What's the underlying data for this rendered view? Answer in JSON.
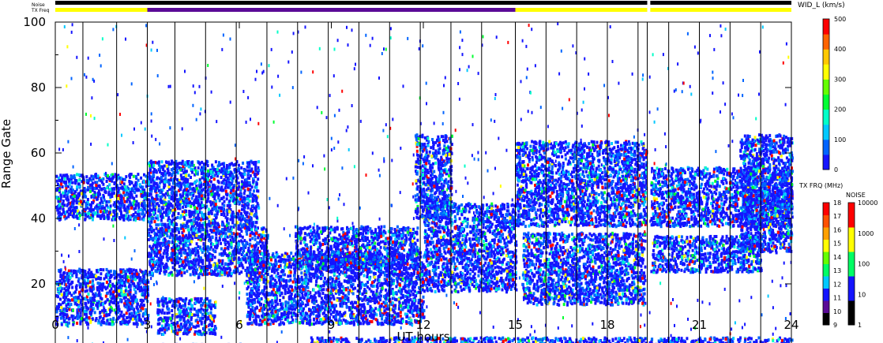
{
  "header": {
    "noise_label": "Noise",
    "txfreq_label": "TX Freq"
  },
  "chart_data": {
    "type": "heatmap",
    "title": "",
    "xlabel": "UT hours",
    "ylabel": "Range Gate",
    "xlim": [
      0,
      24
    ],
    "ylim": [
      0,
      100
    ],
    "x_ticks": [
      "0",
      "3",
      "6",
      "9",
      "12",
      "15",
      "18",
      "21",
      "24"
    ],
    "y_ticks": [
      "0",
      "20",
      "40",
      "60",
      "80",
      "100"
    ],
    "grid_vertical_hours": [
      0.9,
      2.0,
      3.0,
      3.9,
      4.9,
      5.9,
      6.9,
      7.9,
      8.9,
      9.9,
      10.9,
      11.9,
      12.9,
      13.9,
      15.0,
      16.0,
      17.0,
      18.0,
      19.0,
      20.0,
      21.0,
      22.0,
      23.0
    ],
    "data_gap_hour": 19.3,
    "noise_bar": [
      {
        "start": 0,
        "end": 19.3,
        "color": "#000000"
      },
      {
        "start": 19.4,
        "end": 24,
        "color": "#000000"
      }
    ],
    "txfreq_bar": [
      {
        "start": 0,
        "end": 3.0,
        "color": "#ffff00"
      },
      {
        "start": 3.0,
        "end": 15.0,
        "color": "#5a0a96"
      },
      {
        "start": 15.0,
        "end": 19.3,
        "color": "#ffff00"
      },
      {
        "start": 19.4,
        "end": 24,
        "color": "#ffff00"
      }
    ],
    "scatter_bands": [
      {
        "t0": 0.0,
        "t1": 3.0,
        "g0": 8,
        "g1": 25
      },
      {
        "t0": 0.0,
        "t1": 3.0,
        "g0": 40,
        "g1": 54
      },
      {
        "t0": 3.0,
        "t1": 6.9,
        "g0": 23,
        "g1": 38
      },
      {
        "t0": 3.0,
        "t1": 6.6,
        "g0": 38,
        "g1": 58
      },
      {
        "t0": 3.3,
        "t1": 5.2,
        "g0": 5,
        "g1": 16
      },
      {
        "t0": 6.2,
        "t1": 12.0,
        "g0": 8,
        "g1": 30
      },
      {
        "t0": 7.8,
        "t1": 11.8,
        "g0": 25,
        "g1": 38
      },
      {
        "t0": 12.0,
        "t1": 15.0,
        "g0": 18,
        "g1": 45
      },
      {
        "t0": 11.7,
        "t1": 12.9,
        "g0": 40,
        "g1": 66
      },
      {
        "t0": 15.0,
        "t1": 19.3,
        "g0": 38,
        "g1": 64
      },
      {
        "t0": 15.2,
        "t1": 19.2,
        "g0": 14,
        "g1": 36
      },
      {
        "t0": 19.4,
        "t1": 24.0,
        "g0": 38,
        "g1": 56
      },
      {
        "t0": 19.4,
        "t1": 23.0,
        "g0": 24,
        "g1": 35
      },
      {
        "t0": 22.3,
        "t1": 24.0,
        "g0": 30,
        "g1": 66
      },
      {
        "t0": 8.3,
        "t1": 24.0,
        "g0": 0,
        "g1": 4
      },
      {
        "t0": 0.0,
        "t1": 8.3,
        "g0": 0,
        "g1": 2
      }
    ],
    "colorbars": [
      {
        "label": "WID_L (km/s)",
        "ticks": [
          "0",
          "100",
          "200",
          "300",
          "400",
          "500"
        ],
        "colors": [
          "#1414ff",
          "#0064ff",
          "#00c8ff",
          "#00ffc8",
          "#00ff32",
          "#64ff00",
          "#ffff00",
          "#ffc800",
          "#ff6400",
          "#ff0000"
        ]
      },
      {
        "label": "TX FRQ (MHz)",
        "ticks": [
          "9",
          "10",
          "11",
          "12",
          "13",
          "14",
          "15",
          "16",
          "17",
          "18"
        ],
        "colors": [
          "#000000",
          "#5a0a96",
          "#1414ff",
          "#00c8ff",
          "#00ff64",
          "#64ff00",
          "#ffff00",
          "#ffa000",
          "#ff5000",
          "#ff0000"
        ]
      },
      {
        "label": "NOISE",
        "ticks": [
          "1",
          "10",
          "100",
          "1000",
          "10000"
        ],
        "colors": [
          "#000000",
          "#1414ff",
          "#00ff64",
          "#ffff00",
          "#ff0000"
        ]
      }
    ]
  }
}
